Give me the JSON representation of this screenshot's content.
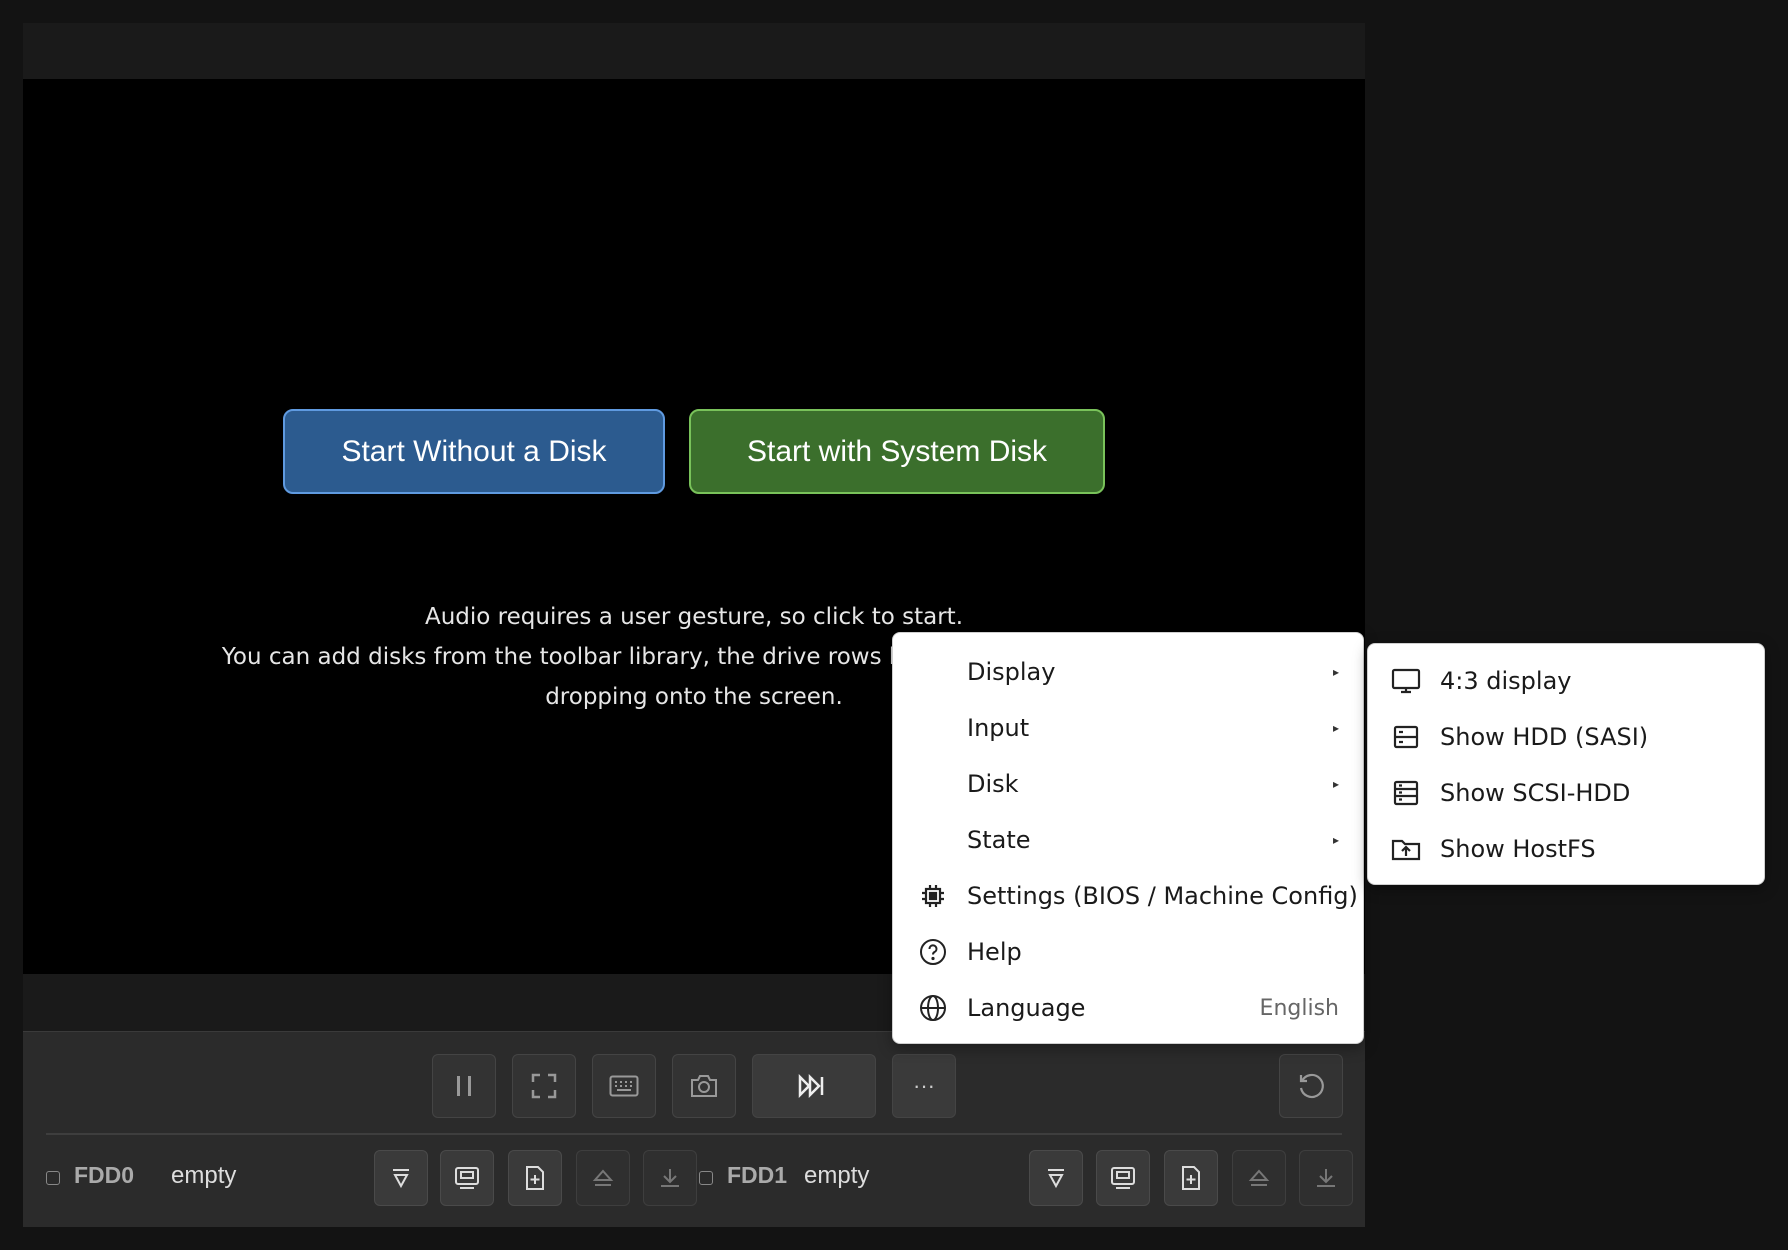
{
  "screen": {
    "start_without_label": "Start Without a Disk",
    "start_system_label": "Start with System Disk",
    "hint_lines": [
      "Audio requires a user gesture, so click to start.",
      "You can add disks from the toolbar library, the drive rows below, or by dragging &",
      "dropping onto the screen."
    ]
  },
  "toolbar": {
    "buttons": [
      "pause-icon",
      "fullscreen-icon",
      "keyboard-icon",
      "camera-icon",
      "fast-forward-icon",
      "more-icon",
      "reset-icon"
    ],
    "more_label": "···"
  },
  "drives": [
    {
      "label": "FDD0",
      "status": "empty"
    },
    {
      "label": "FDD1",
      "status": "empty"
    }
  ],
  "menu": {
    "items": [
      {
        "label": "Display",
        "submenu": true
      },
      {
        "label": "Input",
        "submenu": true
      },
      {
        "label": "Disk",
        "submenu": true
      },
      {
        "label": "State",
        "submenu": true
      },
      {
        "label": "Settings (BIOS / Machine Config)",
        "icon": "chip-icon"
      },
      {
        "label": "Help",
        "icon": "help-circle-icon"
      },
      {
        "label": "Language",
        "icon": "globe-icon",
        "value": "English"
      }
    ],
    "arrow": "▸"
  },
  "submenu": {
    "items": [
      {
        "label": "4:3 display",
        "icon": "monitor-icon"
      },
      {
        "label": "Show HDD (SASI)",
        "icon": "hdd-icon"
      },
      {
        "label": "Show SCSI-HDD",
        "icon": "server-icon"
      },
      {
        "label": "Show HostFS",
        "icon": "folder-upload-icon"
      }
    ]
  },
  "colors": {
    "start_without_bg": "#2c5b8f",
    "start_system_bg": "#3b6f2c",
    "menu_bg": "#ffffff"
  }
}
